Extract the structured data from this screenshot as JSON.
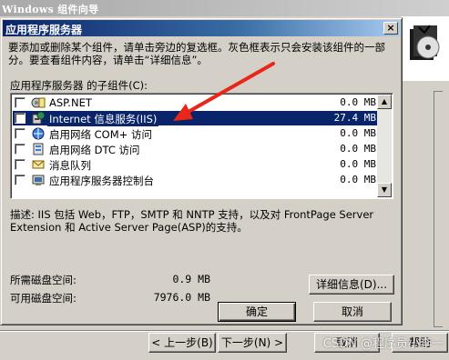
{
  "background_window": {
    "title": "Windows 组件向导",
    "buttons": {
      "back": "< 上一步(B)",
      "next": "下一步(N) >",
      "cancel": "取消",
      "help": "帮助"
    }
  },
  "dialog": {
    "title": "应用程序服务器",
    "close_glyph": "×",
    "instructions": "要添加或删除某个组件，请单击旁边的复选框。灰色框表示只会安装该组件的一部分。要查看组件内容，请单击“详细信息”。",
    "list_label": "应用程序服务器 的子组件(C):",
    "components": [
      {
        "name": "ASP.NET",
        "size": "0.0 MB",
        "icon": "aspnet-icon",
        "checked": false,
        "selected": false
      },
      {
        "name": "Internet 信息服务(IIS)",
        "size": "27.4 MB",
        "icon": "iis-icon",
        "checked": false,
        "selected": true
      },
      {
        "name": "启用网络 COM+ 访问",
        "size": "0.0 MB",
        "icon": "com-icon",
        "checked": false,
        "selected": false
      },
      {
        "name": "启用网络 DTC 访问",
        "size": "0.0 MB",
        "icon": "dtc-icon",
        "checked": false,
        "selected": false
      },
      {
        "name": "消息队列",
        "size": "0.0 MB",
        "icon": "message-queue-icon",
        "checked": false,
        "selected": false
      },
      {
        "name": "应用程序服务器控制台",
        "size": "0.0 MB",
        "icon": "console-icon",
        "checked": false,
        "selected": false
      }
    ],
    "description_label": "描述:",
    "description": "IIS 包括 Web，FTP，SMTP 和 NNTP 支持，以及对 FrontPage Server Extension 和 Active Server Page(ASP)的支持。",
    "required_space_label": "所需磁盘空间:",
    "required_space_value": "0.9 MB",
    "available_space_label": "可用磁盘空间:",
    "available_space_value": "7976.0 MB",
    "buttons": {
      "details": "详细信息(D)...",
      "ok": "确定",
      "cancel": "取消"
    }
  },
  "annotation": {
    "arrow_color": "#e8261a"
  },
  "watermark": "CSDN @程序员小李一",
  "colors": {
    "selection": "#0a246a",
    "face": "#d4d0c8",
    "title_start": "#0a246a",
    "title_end": "#a6caf0"
  }
}
